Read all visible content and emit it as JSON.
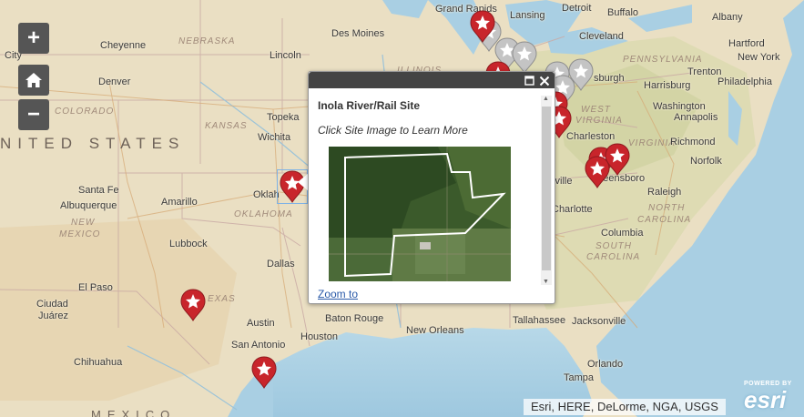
{
  "controls": {
    "zoom_in": "+",
    "zoom_out": "−",
    "home_icon": "home-icon"
  },
  "country_labels": {
    "us": "NITED STATES",
    "mexico": "MEXICO"
  },
  "state_labels": {
    "nebraska": "NEBRASKA",
    "colorado": "COLORADO",
    "kansas": "KANSAS",
    "oklahoma": "OKLAHOMA",
    "new_mexico_1": "NEW",
    "new_mexico_2": "MEXICO",
    "texas": "EXAS",
    "illinois": "ILLINOIS",
    "pennsylvania": "PENNSYLVANIA",
    "west_virginia_1": "WEST",
    "west_virginia_2": "VIRGINIA",
    "virginia": "VIRGINIA",
    "north_carolina_1": "NORTH",
    "north_carolina_2": "CAROLINA",
    "south_carolina_1": "SOUTH",
    "south_carolina_2": "CAROLINA"
  },
  "cities": {
    "grand_rapids": "Grand Rapids",
    "lansing": "Lansing",
    "detroit": "Detroit",
    "buffalo": "Buffalo",
    "albany": "Albany",
    "cheyenne": "Cheyenne",
    "des_moines": "Des Moines",
    "cleveland": "Cleveland",
    "hartford": "Hartford",
    "new_york": "New York",
    "lincoln": "Lincoln",
    "denver": "Denver",
    "trenton": "Trenton",
    "pittsburgh": "sburgh",
    "harrisburg": "Harrisburg",
    "philadelphia": "Philadelphia",
    "topeka": "Topeka",
    "washington": "Washington",
    "annapolis": "Annapolis",
    "charleston": "Charleston",
    "wichita": "Wichita",
    "richmond": "Richmond",
    "norfolk": "Norfolk",
    "santa_fe": "Santa Fe",
    "amarillo": "Amarillo",
    "oklahoma_city": "Oklah",
    "greensboro": "Greensboro",
    "knoxville": "xville",
    "albuquerque": "Albuquerque",
    "raleigh": "Raleigh",
    "charlotte": "Charlotte",
    "lubbock": "Lubbock",
    "columbia": "Columbia",
    "dallas": "Dallas",
    "el_paso": "El Paso",
    "ciudad_juarez_1": "Ciudad",
    "ciudad_juarez_2": "Juárez",
    "austin": "Austin",
    "baton_rouge": "Baton Rouge",
    "tallahassee": "Tallahassee",
    "jacksonville": "Jacksonville",
    "new_orleans": "New Orleans",
    "houston": "Houston",
    "san_antonio": "San Antonio",
    "chihuahua": "Chihuahua",
    "orlando": "Orlando",
    "tampa": "Tampa",
    "city_left": "City"
  },
  "popup": {
    "title": "Inola River/Rail Site",
    "subtitle": "Click Site Image to Learn More",
    "zoom_link": "Zoom to",
    "maximize_icon": "maximize-icon",
    "close_icon": "close-icon"
  },
  "attribution": "Esri, HERE, DeLorme, NGA, USGS",
  "esri_logo": {
    "powered_by": "POWERED BY",
    "brand": "esri"
  },
  "colors": {
    "marker_red": "#c8252b",
    "marker_gray": "#b9b9b9",
    "water": "#a9cfe3",
    "land": "#eadfc3",
    "control_bg": "#555555"
  }
}
